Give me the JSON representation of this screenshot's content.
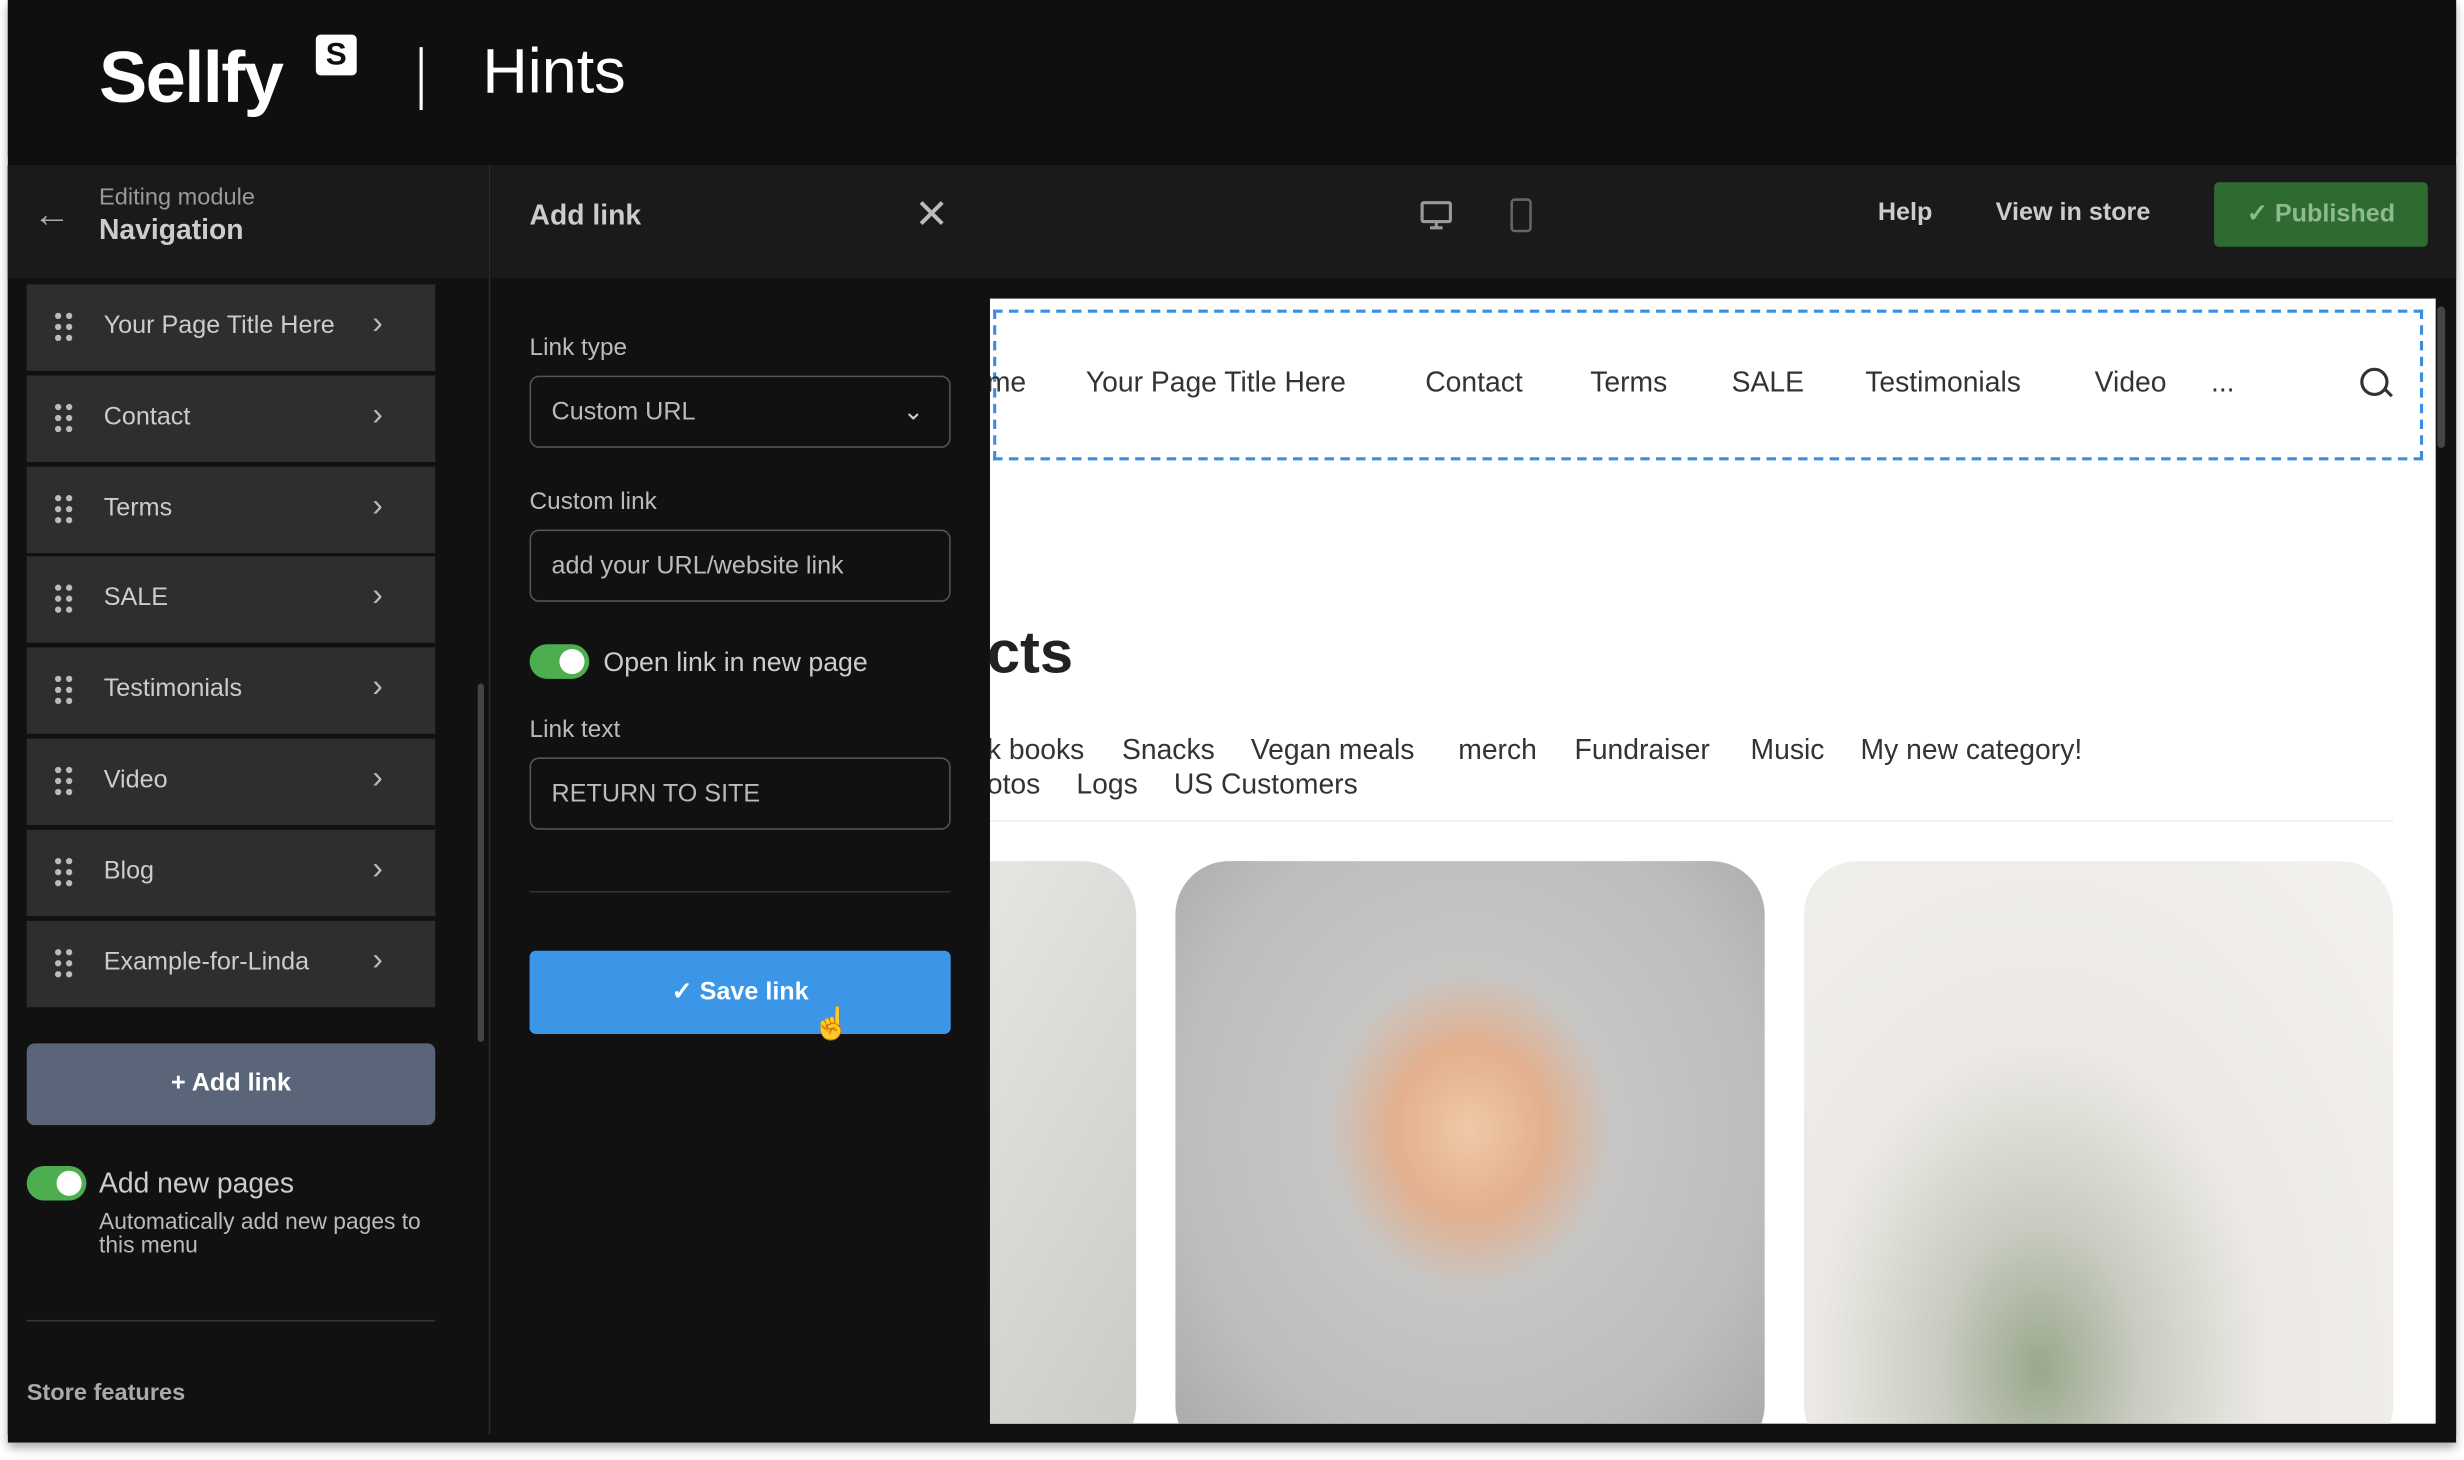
{
  "brand": {
    "logo": "Sellfy",
    "logo_badge": "S",
    "section": "Hints"
  },
  "left": {
    "back_icon": "arrow-left-icon",
    "subtitle": "Editing module",
    "title": "Navigation",
    "items": [
      {
        "label": "Your Page Title Here"
      },
      {
        "label": "Contact"
      },
      {
        "label": "Terms"
      },
      {
        "label": "SALE"
      },
      {
        "label": "Testimonials"
      },
      {
        "label": "Video"
      },
      {
        "label": "Blog"
      },
      {
        "label": "Example-for-Linda"
      }
    ],
    "add_link": "+  Add link",
    "add_new_pages": {
      "label": "Add new pages",
      "description": "Automatically add new pages to this menu",
      "on": true
    },
    "store_features": "Store features"
  },
  "panel": {
    "title": "Add link",
    "close": "✕",
    "link_type_label": "Link type",
    "link_type_value": "Custom URL",
    "custom_link_label": "Custom link",
    "custom_link_placeholder": "add your URL/website link",
    "open_new_page": {
      "label": "Open link in new page",
      "on": true
    },
    "link_text_label": "Link text",
    "link_text_value": "RETURN TO SITE",
    "save": "✓  Save link"
  },
  "topbar": {
    "help": "Help",
    "view_in_store": "View in store",
    "published": "✓  Published"
  },
  "preview": {
    "nav": [
      "me",
      "Your Page Title Here",
      "Contact",
      "Terms",
      "SALE",
      "Testimonials",
      "Video",
      "..."
    ],
    "heading": "cts",
    "categories_row1": [
      "k books",
      "Snacks",
      "Vegan meals",
      "merch",
      "Fundraiser",
      "Music",
      "My new category!"
    ],
    "categories_row2": [
      "otos",
      "Logs",
      "US Customers"
    ]
  },
  "colors": {
    "accent": "#3b96e8",
    "toggle": "#4cae4f",
    "published": "#2e6b30"
  }
}
